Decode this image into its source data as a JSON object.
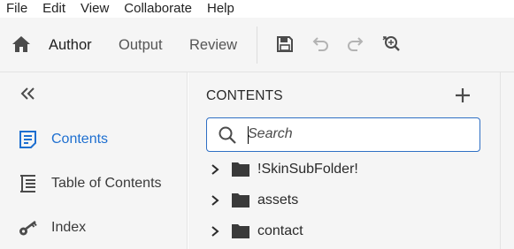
{
  "menubar": {
    "items": [
      {
        "label": "File"
      },
      {
        "label": "Edit"
      },
      {
        "label": "View"
      },
      {
        "label": "Collaborate"
      },
      {
        "label": "Help"
      }
    ]
  },
  "toolbar": {
    "home_icon": "home-icon",
    "tabs": [
      {
        "label": "Author",
        "active": true
      },
      {
        "label": "Output",
        "active": false
      },
      {
        "label": "Review",
        "active": false
      }
    ],
    "actions": [
      {
        "icon": "save-icon",
        "enabled": true
      },
      {
        "icon": "undo-icon",
        "enabled": false
      },
      {
        "icon": "redo-icon",
        "enabled": false
      },
      {
        "icon": "find-replace-icon",
        "enabled": true
      }
    ]
  },
  "sidebar": {
    "collapse_icon": "double-chevron-left-icon",
    "items": [
      {
        "label": "Contents",
        "icon": "contents-icon",
        "active": true
      },
      {
        "label": "Table of Contents",
        "icon": "table-of-contents-icon",
        "active": false
      },
      {
        "label": "Index",
        "icon": "key-icon",
        "active": false
      }
    ]
  },
  "contents_panel": {
    "title": "CONTENTS",
    "add_icon": "plus-icon",
    "search": {
      "placeholder": "Search",
      "value": ""
    },
    "tree": [
      {
        "label": "!SkinSubFolder!",
        "icon": "folder-icon",
        "expanded": false
      },
      {
        "label": "assets",
        "icon": "folder-icon",
        "expanded": false
      },
      {
        "label": "contact",
        "icon": "folder-icon",
        "expanded": false
      }
    ]
  },
  "colors": {
    "accent": "#1e6fd0",
    "search_border": "#2f6fc4",
    "panel_bg": "#f5f5f5",
    "icon_dark": "#4b4b4b",
    "icon_disabled": "#b3b3b3"
  }
}
